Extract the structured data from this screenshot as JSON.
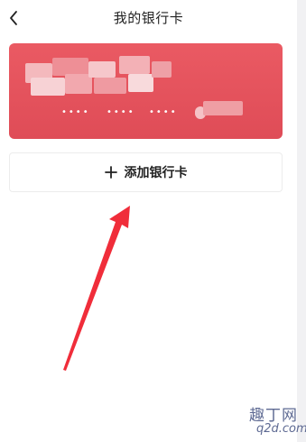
{
  "header": {
    "title": "我的银行卡",
    "back_icon": "chevron-left-icon"
  },
  "card": {
    "number_groups": [
      "••••",
      "••••",
      "••••"
    ],
    "accent_color": "#e2515b"
  },
  "add_card": {
    "label": "添加银行卡",
    "icon": "plus-icon"
  },
  "annotation": {
    "arrow_color": "#f02d3a"
  },
  "watermark": {
    "logo_text": "趣丁网",
    "domain_text": "q2d.com"
  }
}
